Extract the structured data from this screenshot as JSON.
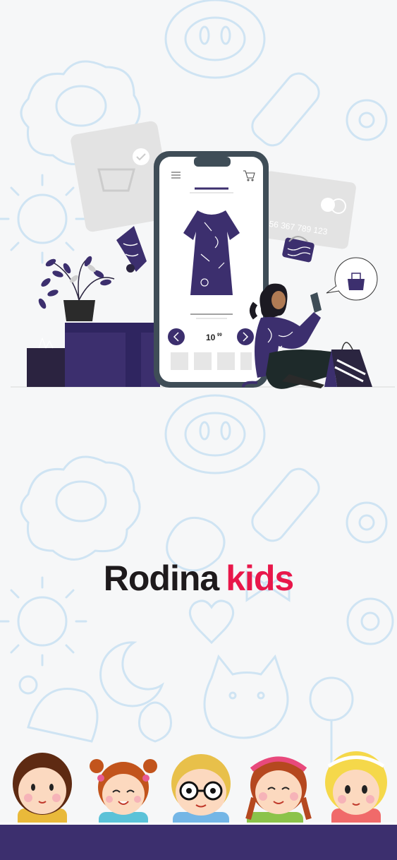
{
  "brand": {
    "word1": "Rodina",
    "word2": "kids"
  },
  "phone": {
    "price_main": "10",
    "price_cents": "99"
  },
  "card": {
    "number": "56 367 789 123"
  },
  "colors": {
    "brand_dark": "#1e1a1c",
    "brand_accent": "#e8174a",
    "purple": "#3c2f6e",
    "doodle": "#cfe4f3"
  }
}
